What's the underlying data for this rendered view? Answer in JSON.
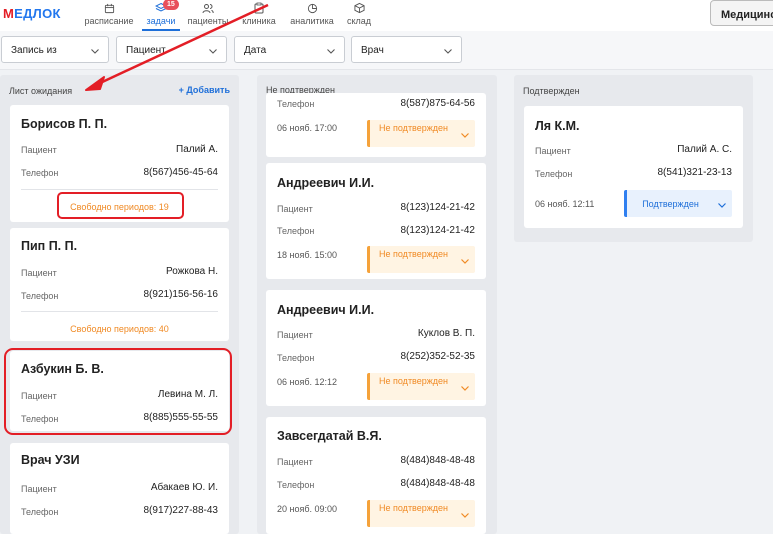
{
  "app": {
    "logo_text": "МЕДЛОК"
  },
  "nav": [
    {
      "label": "расписание",
      "icon": "calendar-icon"
    },
    {
      "label": "задачи",
      "icon": "layers-icon",
      "badge": "15",
      "active": true
    },
    {
      "label": "пациенты",
      "icon": "users-icon"
    },
    {
      "label": "клиника",
      "icon": "clipboard-icon"
    },
    {
      "label": "аналитика",
      "icon": "pie-chart-icon"
    },
    {
      "label": "склад",
      "icon": "box-icon"
    }
  ],
  "top_right": {
    "label": "Медицинск"
  },
  "filters": [
    {
      "label": "Запись из"
    },
    {
      "label": "Пациент"
    },
    {
      "label": "Дата"
    },
    {
      "label": "Врач"
    }
  ],
  "columns": {
    "waiting": {
      "title": "Лист ожидания",
      "add_label": "+ Добавить",
      "cards": [
        {
          "name": "Борисов П. П.",
          "patient_label": "Пациент",
          "patient": "Палий А.",
          "phone_label": "Телефон",
          "phone": "8(567)456-45-64",
          "free_periods": "Свободно периодов: 19"
        },
        {
          "name": "Пип П. П.",
          "patient_label": "Пациент",
          "patient": "Рожкова Н.",
          "phone_label": "Телефон",
          "phone": "8(921)156-56-16",
          "free_periods": "Свободно периодов: 40"
        },
        {
          "name": "Азбукин Б. В.",
          "patient_label": "Пациент",
          "patient": "Левина М. Л.",
          "phone_label": "Телефон",
          "phone": "8(885)555-55-55"
        },
        {
          "name": "Врач УЗИ",
          "patient_label": "Пациент",
          "patient": "Абакаев Ю. И.",
          "phone_label": "Телефон",
          "phone": "8(917)227-88-43"
        }
      ]
    },
    "unconfirmed": {
      "title": "Не подтвержден",
      "cards": [
        {
          "phone_label": "Телефон",
          "phone": "8(587)875-64-56",
          "when": "06 нояб. 17:00",
          "status": "Не подтвержден"
        },
        {
          "name": "Андреевич И.И.",
          "patient_label": "Пациент",
          "patient": "8(123)124-21-42",
          "phone_label": "Телефон",
          "phone": "8(123)124-21-42",
          "when": "18 нояб. 15:00",
          "status": "Не подтвержден"
        },
        {
          "name": "Андреевич И.И.",
          "patient_label": "Пациент",
          "patient": "Куклов В. П.",
          "phone_label": "Телефон",
          "phone": "8(252)352-52-35",
          "when": "06 нояб. 12:12",
          "status": "Не подтвержден"
        },
        {
          "name": "Завсегдатай В.Я.",
          "patient_label": "Пациент",
          "patient": "8(484)848-48-48",
          "phone_label": "Телефон",
          "phone": "8(484)848-48-48",
          "when": "20 нояб. 09:00",
          "status": "Не подтвержден"
        }
      ]
    },
    "confirmed": {
      "title": "Подтвержден",
      "cards": [
        {
          "name": "Ля К.М.",
          "patient_label": "Пациент",
          "patient": "Палий А. С.",
          "phone_label": "Телефон",
          "phone": "8(541)321-23-13",
          "when": "06 нояб. 12:11",
          "status": "Подтвержден"
        }
      ]
    }
  },
  "colors": {
    "accent": "#1e6fd9",
    "warning": "#f08a24",
    "annotation": "#e31e26",
    "badge": "#e8505b"
  }
}
